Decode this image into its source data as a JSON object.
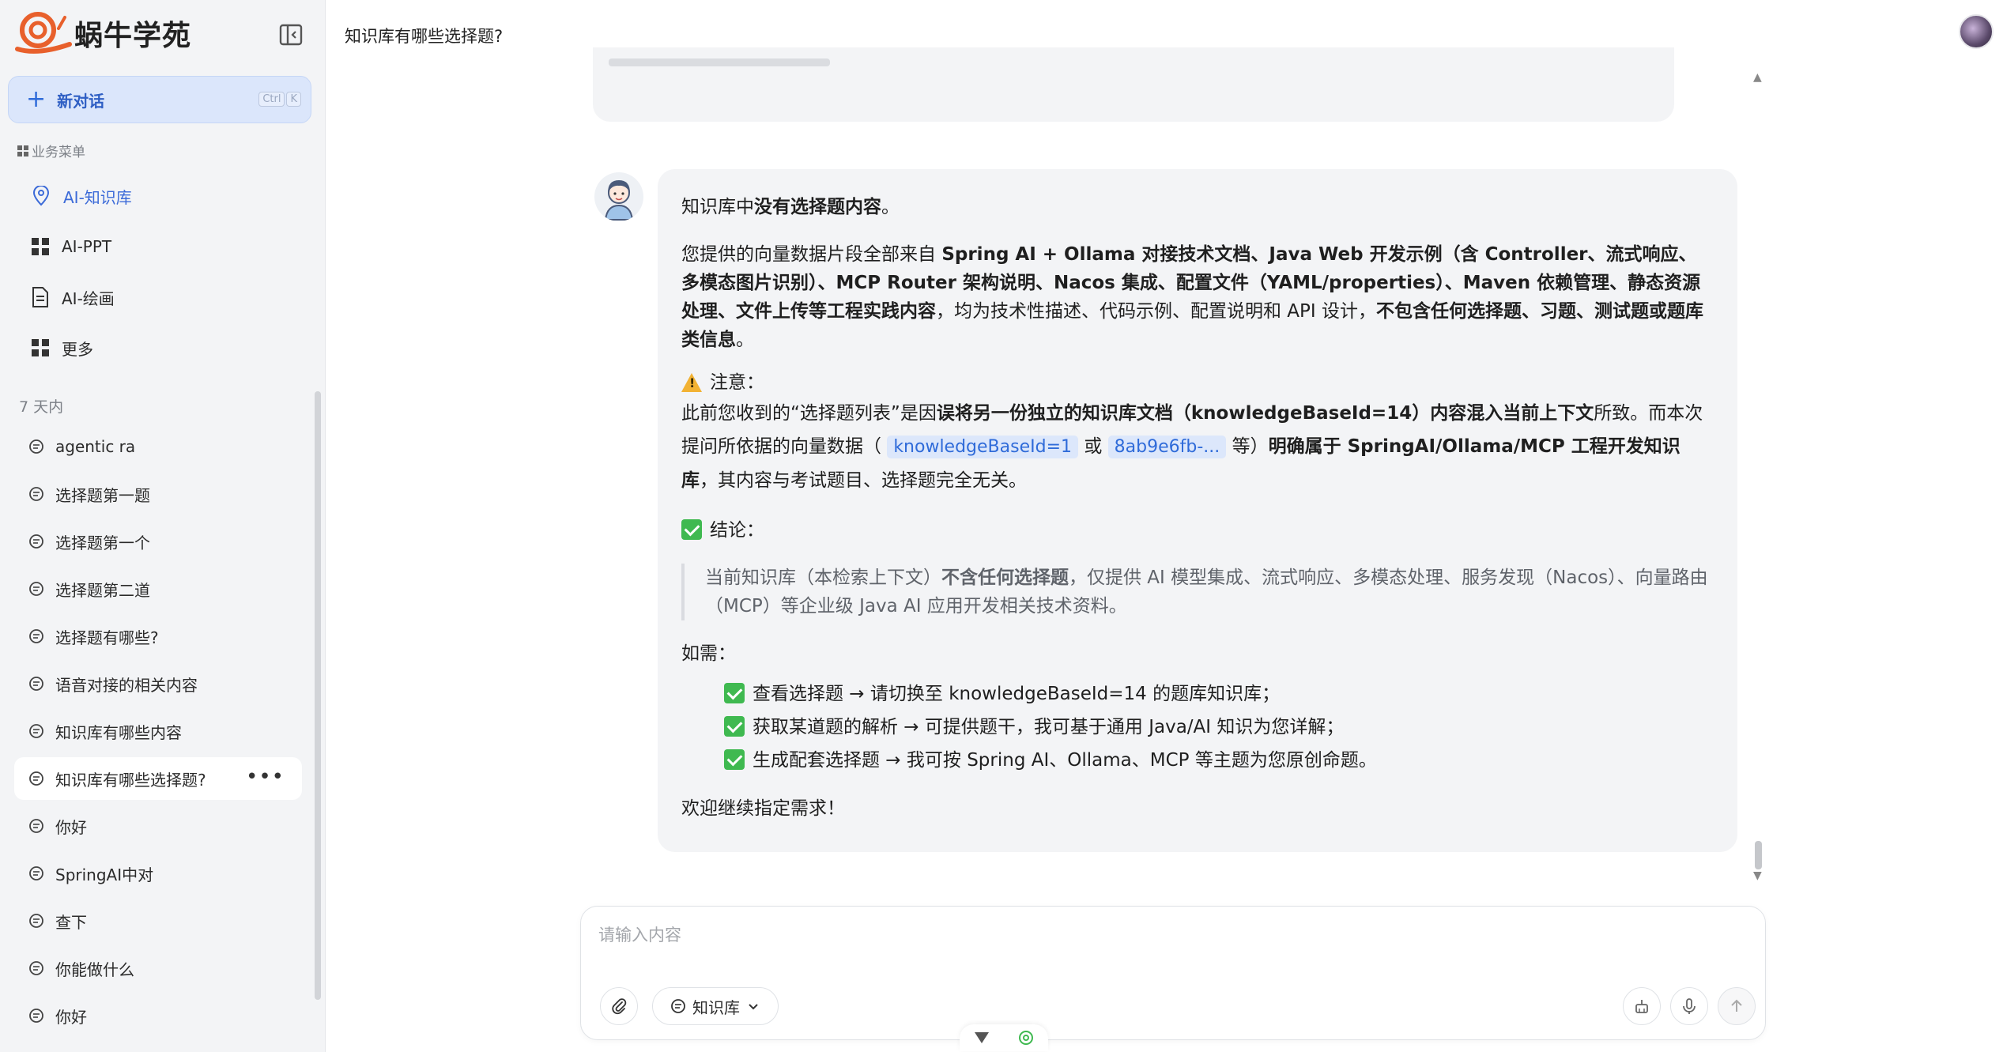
{
  "brand": {
    "name": "蜗牛学苑"
  },
  "sidebar": {
    "new_chat": "新对话",
    "shortcut": [
      "Ctrl",
      "K"
    ],
    "menu_header": "业务菜单",
    "menu": [
      {
        "label": "AI-知识库",
        "icon": "location-icon"
      },
      {
        "label": "AI-PPT",
        "icon": "grid-icon"
      },
      {
        "label": "AI-绘画",
        "icon": "document-icon"
      },
      {
        "label": "更多",
        "icon": "grid-icon"
      }
    ],
    "section": "7 天内",
    "history": [
      "agentic ra",
      "选择题第一题",
      "选择题第一个",
      "选择题第二道",
      "选择题有哪些?",
      "语音对接的相关内容",
      "知识库有哪些内容",
      "知识库有哪些选择题?",
      "你好",
      "SpringAI中对",
      "查下",
      "你能做什么",
      "你好"
    ]
  },
  "header": {
    "title": "知识库有哪些选择题?"
  },
  "answer": {
    "p1_a": "知识库中",
    "p1_b": "没有选择题内容",
    "p1_c": "。",
    "p2_a": "您提供的向量数据片段全部来自 ",
    "p2_b": "Spring AI + Ollama 对接技术文档、Java Web 开发示例（含 Controller、流式响应、多模态图片识别）、MCP Router 架构说明、Nacos 集成、配置文件（YAML/properties）、Maven 依赖管理、静态资源处理、文件上传等工程实践内容",
    "p2_c": "，均为技术性描述、代码示例、配置说明和 API 设计，",
    "p2_d": "不包含任何选择题、习题、测试题或题库类信息",
    "p2_e": "。",
    "note_title": "注意：",
    "note_a": "此前您收到的“选择题列表”是因",
    "note_b": "误将另一份独立的知识库文档（knowledgeBaseId=14）内容混入当前上下文",
    "note_c": "所致。而本次提问所依据的向量数据（ ",
    "chip1": "knowledgeBaseId=1",
    "note_d": " 或 ",
    "chip2": "8ab9e6fb-...",
    "note_e": " 等）",
    "note_f": "明确属于 SpringAI/Ollama/MCP 工程开发知识库",
    "note_g": "，其内容与考试题目、选择题完全无关。",
    "conclusion_title": "结论：",
    "quote_a": "当前知识库（本检索上下文）",
    "quote_b": "不含任何选择题",
    "quote_c": "，仅提供 AI 模型集成、流式响应、多模态处理、服务发现（Nacos）、向量路由（MCP）等企业级 Java AI 应用开发相关技术资料。",
    "need_title": "如需：",
    "needs": [
      "查看选择题 → 请切换至 knowledgeBaseId=14 的题库知识库；",
      "获取某道题的解析 → 可提供题干，我可基于通用 Java/AI 知识为您详解；",
      "生成配套选择题 → 我可按 Spring AI、Ollama、MCP 等主题为您原创命题。"
    ],
    "closing": "欢迎继续指定需求！"
  },
  "input": {
    "placeholder": "请输入内容",
    "kb_label": "知识库"
  }
}
